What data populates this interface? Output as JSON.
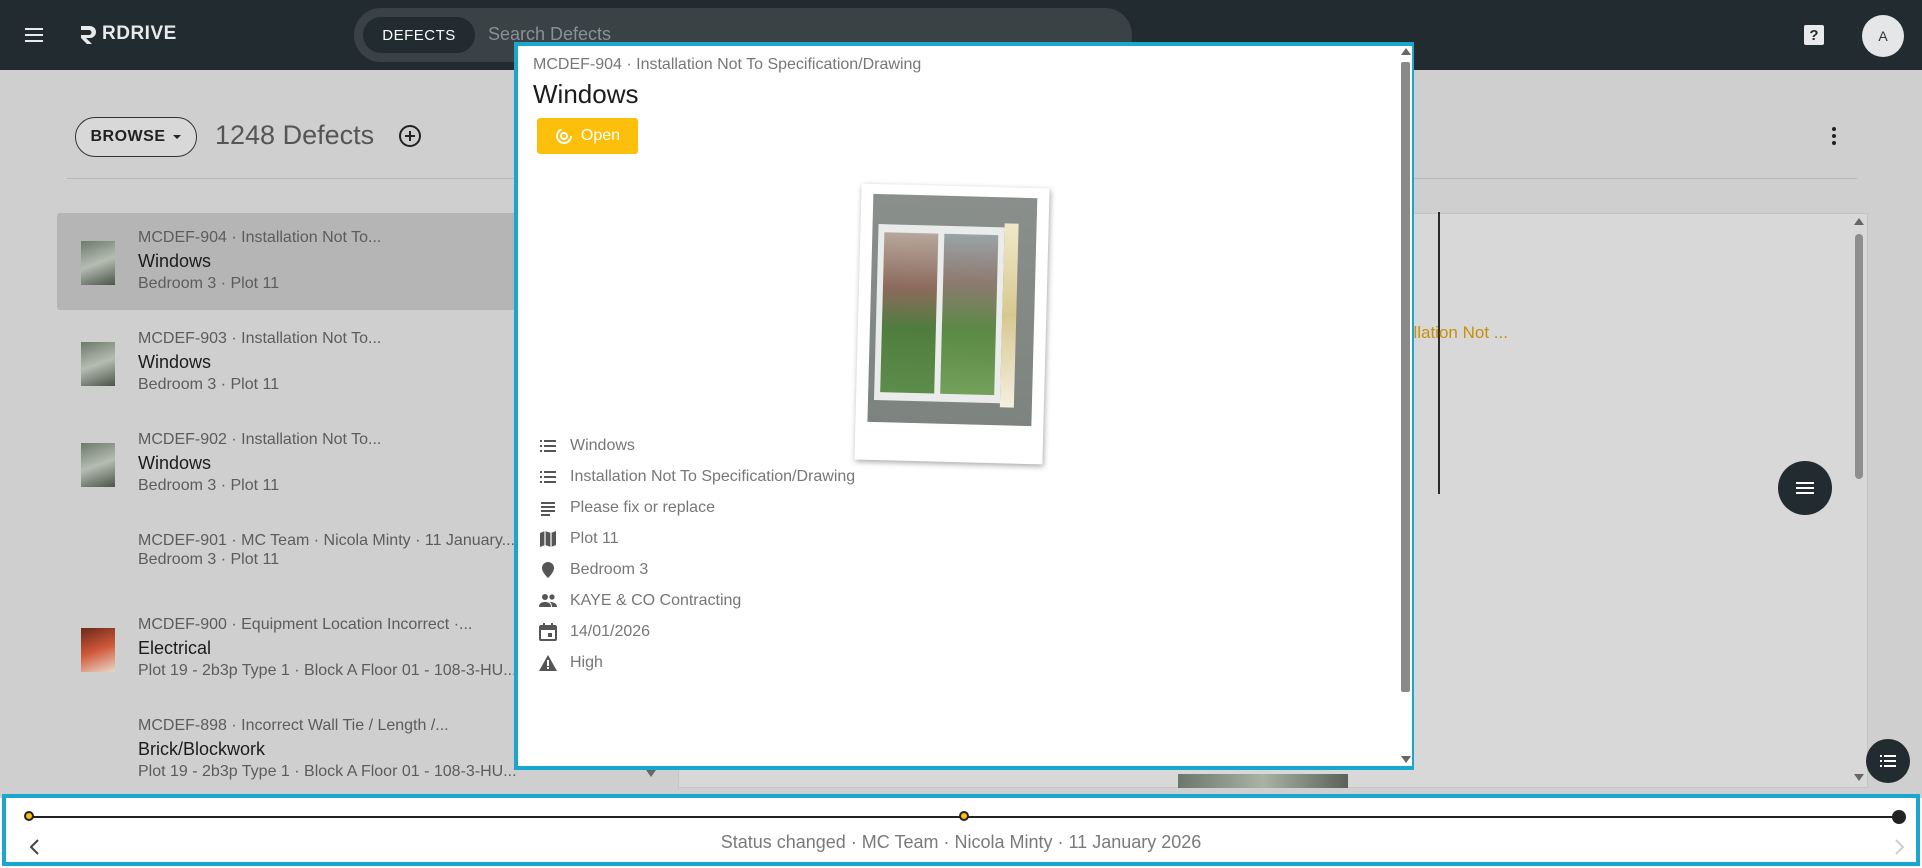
{
  "app": {
    "brand": "RDRIVE",
    "search_scope": "DEFECTS",
    "search_placeholder": "Search Defects",
    "avatar_initial": "A"
  },
  "toolbar": {
    "browse_label": "BROWSE",
    "defects_count": "1248 Defects"
  },
  "list": [
    {
      "code": "MCDEF-904 · Installation Not To...",
      "title": "Windows",
      "sub": "Bedroom 3 · Plot 11",
      "selected": true
    },
    {
      "code": "MCDEF-903 · Installation Not To...",
      "title": "Windows",
      "sub": "Bedroom 3 · Plot 11"
    },
    {
      "code": "MCDEF-902 · Installation Not To...",
      "title": "Windows",
      "sub": "Bedroom 3 · Plot 11"
    },
    {
      "code": "MCDEF-901 · MC Team · Nicola Minty · 11 January...",
      "title": "",
      "sub": "Bedroom 3 · Plot 11"
    },
    {
      "code": "MCDEF-900 · Equipment Location Incorrect ·...",
      "title": "Electrical",
      "sub": "Plot 19 - 2b3p Type 1 · Block A Floor 01 - 108-3-HU..."
    },
    {
      "code": "MCDEF-898 · Incorrect Wall Tie / Length /...",
      "title": "Brick/Blockwork",
      "sub": "Plot 19 - 2b3p Type 1 · Block A Floor 01 - 108-3-HU..."
    }
  ],
  "background_detail": {
    "fragment": "allation Not ..."
  },
  "modal": {
    "code_line": "MCDEF-904 · Installation Not To Specification/Drawing",
    "title": "Windows",
    "status": "Open",
    "status_color": "#fbbf0c",
    "fields": [
      {
        "icon": "list-icon",
        "value": "Windows"
      },
      {
        "icon": "list-icon",
        "value": "Installation Not To Specification/Drawing"
      },
      {
        "icon": "notes-icon",
        "value": "Please fix or replace"
      },
      {
        "icon": "map-icon",
        "value": "Plot 11"
      },
      {
        "icon": "location-pin-icon",
        "value": "Bedroom 3"
      },
      {
        "icon": "people-icon",
        "value": "KAYE & CO Contracting"
      },
      {
        "icon": "calendar-icon",
        "value": "14/01/2026"
      },
      {
        "icon": "warning-icon",
        "value": "High"
      }
    ]
  },
  "timeline": {
    "event_text": "Status changed · MC Team · Nicola Minty · 11 January 2026"
  },
  "colors": {
    "topbar": "#222b30",
    "highlight_border": "#1aa7cf",
    "accent_amber": "#fbbf0c"
  }
}
